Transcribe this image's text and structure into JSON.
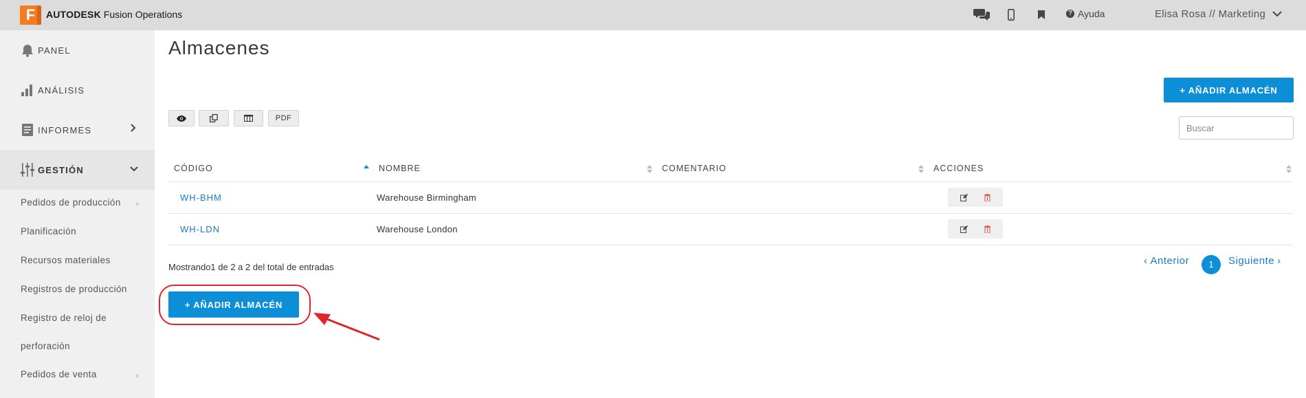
{
  "app": {
    "logo_letter": "F",
    "brand_bold": "AUTODESK",
    "brand_rest": "Fusion Operations",
    "help_label": "Ayuda",
    "user_label": "Elisa Rosa // Marketing",
    "icons": [
      "chat-icon",
      "mobile-icon",
      "bookmark-icon",
      "help-icon",
      "chevron-down-icon"
    ]
  },
  "sidebar": {
    "main": [
      {
        "label": "PANEL",
        "icon": "bell-icon"
      },
      {
        "label": "ANÁLISIS",
        "icon": "bar-chart-icon"
      },
      {
        "label": "INFORMES",
        "icon": "document-icon"
      },
      {
        "label": "GESTIÓN",
        "icon": "sliders-icon"
      }
    ],
    "sub": [
      {
        "label": "Pedidos de producción"
      },
      {
        "label": "Planificación"
      },
      {
        "label": "Recursos materiales"
      },
      {
        "label": "Registros de producción"
      },
      {
        "label": "Registro de reloj de"
      },
      {
        "label": "perforación"
      },
      {
        "label": "Pedidos de venta"
      }
    ]
  },
  "main": {
    "title": "Almacenes",
    "add_button": "+ AÑADIR ALMACÉN",
    "toolbar": {
      "pdf_label": "PDF"
    },
    "search_placeholder": "Buscar",
    "columns": [
      "CÓDIGO",
      "NOMBRE",
      "COMENTARIO",
      "ACCIONES"
    ],
    "rows": [
      {
        "code": "WH-BHM",
        "name": "Warehouse Birmingham",
        "comment": ""
      },
      {
        "code": "WH-LDN",
        "name": "Warehouse London",
        "comment": ""
      }
    ],
    "info_text": "Mostrando1 de 2 a 2 del total de entradas",
    "pagination": {
      "prev": "Anterior",
      "current": "1",
      "next": "Siguiente"
    },
    "bottom_add_button": "+ AÑADIR ALMACÉN"
  },
  "colors": {
    "accent": "#0c8fd6",
    "link": "#1a7dc0",
    "annotation": "#e0242a",
    "topbar": "#dcdcdc",
    "sidebar": "#f0f0f0"
  }
}
